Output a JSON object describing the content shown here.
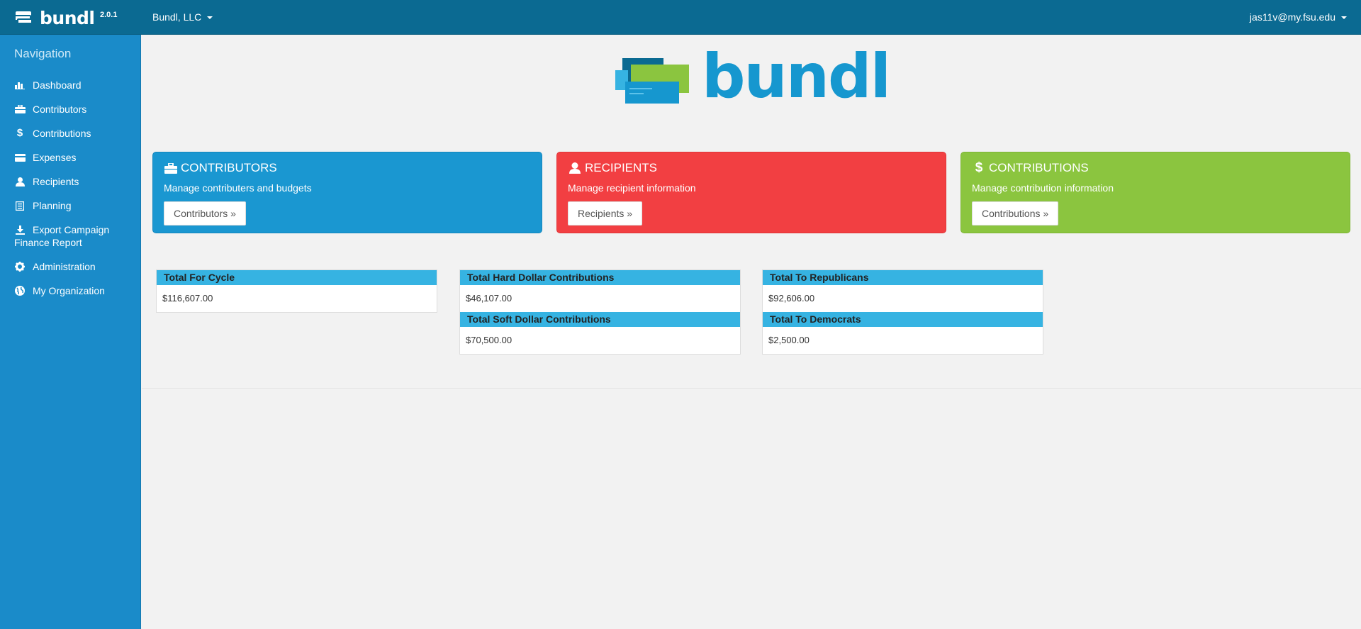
{
  "header": {
    "brand": "bundl",
    "version": "2.0.1",
    "organization": "Bundl, LLC",
    "user": "jas11v@my.fsu.edu"
  },
  "sidebar": {
    "title": "Navigation",
    "items": [
      {
        "label": "Dashboard",
        "icon": "bar-chart-icon"
      },
      {
        "label": "Contributors",
        "icon": "briefcase-icon"
      },
      {
        "label": "Contributions",
        "icon": "dollar-icon"
      },
      {
        "label": "Expenses",
        "icon": "credit-card-icon"
      },
      {
        "label": "Recipients",
        "icon": "user-icon"
      },
      {
        "label": "Planning",
        "icon": "list-icon"
      },
      {
        "label": "Export Campaign Finance Report",
        "icon": "download-icon"
      },
      {
        "label": "Administration",
        "icon": "gear-icon"
      },
      {
        "label": "My Organization",
        "icon": "globe-icon"
      }
    ]
  },
  "logo_text": "bundl",
  "panels": [
    {
      "title": "CONTRIBUTORS",
      "desc": "Manage contributers and budgets",
      "button": "Contributors »",
      "color": "#1a97d1",
      "icon": "briefcase-icon"
    },
    {
      "title": "RECIPIENTS",
      "desc": "Manage recipient information",
      "button": "Recipients »",
      "color": "#f23f42",
      "icon": "user-icon"
    },
    {
      "title": "CONTRIBUTIONS",
      "desc": "Manage contribution information",
      "button": "Contributions »",
      "color": "#8bc53f",
      "icon": "dollar-icon"
    }
  ],
  "stats": {
    "total_cycle": {
      "label": "Total For Cycle",
      "value": "$116,607.00"
    },
    "hard_dollar": {
      "label": "Total Hard Dollar Contributions",
      "value": "$46,107.00"
    },
    "soft_dollar": {
      "label": "Total Soft Dollar Contributions",
      "value": "$70,500.00"
    },
    "republicans": {
      "label": "Total To Republicans",
      "value": "$92,606.00"
    },
    "democrats": {
      "label": "Total To Democrats",
      "value": "$2,500.00"
    }
  },
  "colors": {
    "topbar": "#0b6a92",
    "sidebar": "#1a8bc9",
    "stat_header": "#36b3e2"
  }
}
